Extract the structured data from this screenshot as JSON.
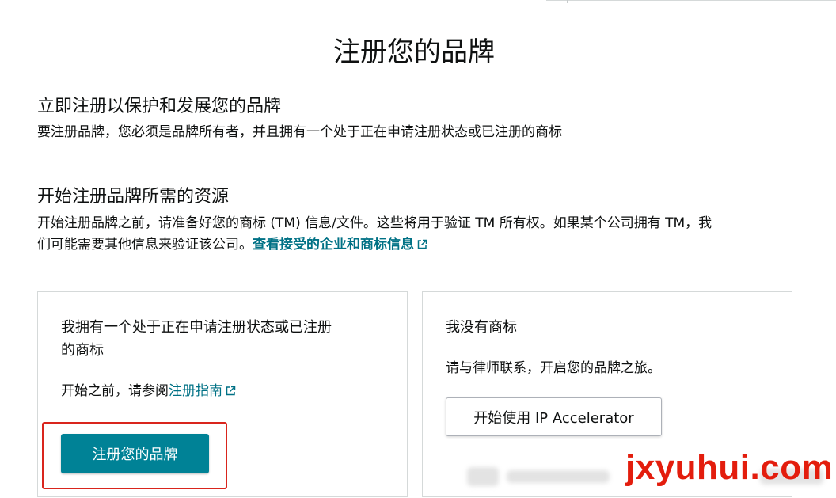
{
  "page": {
    "title": "注册您的品牌"
  },
  "section_register": {
    "heading": "立即注册以保护和发展您的品牌",
    "description": "要注册品牌，您必须是品牌所有者，并且拥有一个处于正在申请注册状态或已注册的商标"
  },
  "section_resources": {
    "heading": "开始注册品牌所需的资源",
    "line1": "开始注册品牌之前，请准备好您的商标 (TM) 信息/文件。这些将用于验证 TM 所有权。如果某个公司拥有 TM，我",
    "line2": "们可能需要其他信息来验证该公司。",
    "link": "查看接受的企业和商标信息"
  },
  "card_has_tm": {
    "title_line1": "我拥有一个处于正在申请注册状态或已注册",
    "title_line2": "的商标",
    "guide_prefix": "开始之前，请参阅",
    "guide_link": "注册指南",
    "button": "注册您的品牌"
  },
  "card_no_tm": {
    "title": "我没有商标",
    "description": "请与律师联系，开启您的品牌之旅。",
    "button": "开始使用 IP Accelerator"
  },
  "watermark": "jxyuhui.com",
  "colors": {
    "accent": "#008296",
    "link": "#007185",
    "highlight": "#d9251d",
    "watermark": "#e31d0d"
  },
  "icons": [
    "external-link-icon"
  ]
}
